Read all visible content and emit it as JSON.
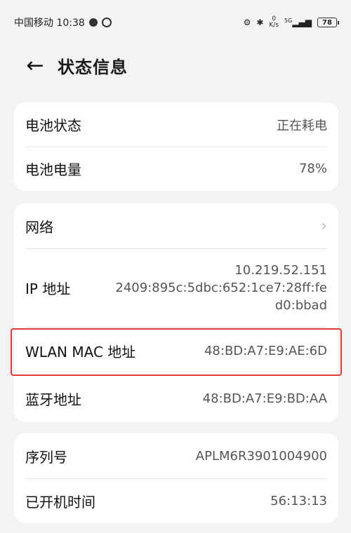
{
  "statusbar": {
    "carrier_time": "中国移动 10:38",
    "speed_value": "0",
    "speed_unit": "K/s",
    "signal": "5G",
    "battery": "78"
  },
  "header": {
    "title": "状态信息",
    "back_icon": "arrow-left-icon"
  },
  "battery_card": [
    {
      "label": "电池状态",
      "value": "正在耗电"
    },
    {
      "label": "电池电量",
      "value": "78%"
    }
  ],
  "network_card": {
    "network_label": "网络",
    "ip_label": "IP 地址",
    "ip_line1": "10.219.52.151",
    "ip_line2": "2409:895c:5dbc:652:1ce7:28ff:fe",
    "ip_line3": "d0:bbad",
    "wlan_label": "WLAN MAC 地址",
    "wlan_value": "48:BD:A7:E9:AE:6D",
    "bt_label": "蓝牙地址",
    "bt_value": "48:BD:A7:E9:BD:AA"
  },
  "device_card": [
    {
      "label": "序列号",
      "value": "APLM6R3901004900"
    },
    {
      "label": "已开机时间",
      "value": "56:13:13"
    }
  ],
  "colors": {
    "highlight": "#e53935",
    "background": "#f1f3f5"
  }
}
